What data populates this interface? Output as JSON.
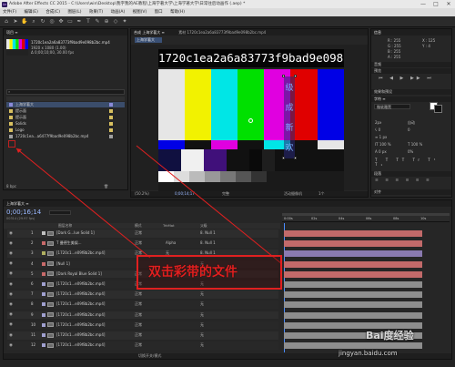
{
  "window": {
    "title": "Adobe After Effects CC 2015 - C:\\Users\\win\\Desktop\\我字我的AE教程\\上海学著大学\\上海学著大学\\日常往后动画作 (.aep) *",
    "icon_label": "Ae",
    "min": "—",
    "max": "□",
    "close": "✕"
  },
  "menu": [
    "文件(F)",
    "编辑(E)",
    "合成(C)",
    "图层(L)",
    "效果(T)",
    "动画(A)",
    "视图(V)",
    "窗口",
    "帮助(H)"
  ],
  "project_panel": {
    "tab": "项目 ≡",
    "preview_name": "1720c1ea2a6a83773f9bad9e098b2bc.mp4",
    "preview_meta_1": "1920 x 1080 (1.00)",
    "preview_meta_2": "Δ 0;00;10;00, 30.00 fps",
    "search_placeholder": "",
    "items": [
      {
        "label": "上海学著大",
        "color": "#8a8ad8"
      },
      {
        "label": "提示面",
        "color": "#d8c060"
      },
      {
        "label": "提示面",
        "color": "#d8c060"
      },
      {
        "label": "Solids",
        "color": "#d8c060"
      },
      {
        "label": "Logo",
        "color": "#d8c060"
      },
      {
        "label": "1720c1ea...a6477f9bad9e098b2bc.mp4",
        "color": "#a0a0a0"
      }
    ],
    "bit_depth": "8 bpc"
  },
  "composition": {
    "tab": "合成 上海学著大 ≡",
    "tab2": "素材 1720c1ea2a6a83773f9bad9e098b2bc.mp4",
    "subtab": "上海学著大",
    "overlay_text": "1720c1ea2a6a83773f9bad9e098",
    "vertical_text": [
      "级",
      "成",
      "新",
      "欢"
    ],
    "zoom": "(50.2%)",
    "timecode": "0;00;14;17",
    "quality": "完整",
    "camera": "活动摄像机",
    "view": "1个"
  },
  "right_panel": {
    "info_tab": "信息",
    "info_values": [
      "R : 255",
      "G : 255",
      "B : 255",
      "A : 255"
    ],
    "info_xy": [
      "X : 125",
      "Y : 4"
    ],
    "audio_tab": "音频",
    "preview_tab": "预览",
    "effects_tab": "效果和预设",
    "character_tab": "字符 ≡",
    "font": "微软雅黑",
    "font_size": "2px",
    "leading": "自动",
    "tracking": "0",
    "tsume": "0%",
    "paragraph_tab": "段落",
    "align_tab": "对齐"
  },
  "timeline": {
    "tab": "上海学著大 ≡",
    "timecode": "0;00;16;14",
    "timecode_sub": "00314 (29.97 fps)",
    "col_name": "图层名称",
    "col_mode": "模式",
    "col_trkmat": "TrkMat",
    "col_parent": "父级",
    "ruler": [
      "0:00s",
      "02s",
      "04s",
      "06s",
      "08s",
      "10s"
    ],
    "footer_label": "切换开关/模式",
    "layers": [
      {
        "num": "1",
        "name": "[Dark G...lue Solid 1]",
        "mode": "正常",
        "trk": "",
        "parent": "8. Null 1",
        "color": "#c0c0c0",
        "bar": "#c26a6a"
      },
      {
        "num": "2",
        "name": "T 曼德生美娱...",
        "mode": "正常",
        "trk": "Alpha",
        "parent": "8. Null 1",
        "color": "#c86a6a",
        "bar": "#c26a6a"
      },
      {
        "num": "3",
        "name": "[1720c1...e09f8b2bc.mp4]",
        "mode": "正常",
        "trk": "无",
        "parent": "8. Null 1",
        "color": "#b0b060",
        "bar": "#8a7ab0"
      },
      {
        "num": "4",
        "name": "[Null 1]",
        "mode": "",
        "trk": "",
        "parent": "无",
        "color": "#c86a6a",
        "bar": "#c26a6a"
      },
      {
        "num": "5",
        "name": "[Dark Royal Blue Solid 1]",
        "mode": "正常",
        "trk": "",
        "parent": "无",
        "color": "#c86a6a",
        "bar": "#c26a6a"
      },
      {
        "num": "6",
        "name": "[1720c1...e09f8b2bc.mp4]",
        "mode": "正常",
        "trk": "",
        "parent": "无",
        "color": "#a0a0d0",
        "bar": "#8e8e8e"
      },
      {
        "num": "7",
        "name": "[1720c1...e09f8b2bc.mp4]",
        "mode": "正常",
        "trk": "",
        "parent": "无",
        "color": "#a0a0d0",
        "bar": "#8e8e8e"
      },
      {
        "num": "8",
        "name": "[1720c1...e09f8b2bc.mp4]",
        "mode": "正常",
        "trk": "",
        "parent": "无",
        "color": "#a0a0d0",
        "bar": "#8e8e8e"
      },
      {
        "num": "9",
        "name": "[1720c1...e09f8b2bc.mp4]",
        "mode": "正常",
        "trk": "",
        "parent": "无",
        "color": "#a0a0d0",
        "bar": "#8e8e8e"
      },
      {
        "num": "10",
        "name": "[1720c1...e09f8b2bc.mp4]",
        "mode": "正常",
        "trk": "",
        "parent": "无",
        "color": "#a0a0d0",
        "bar": "#8e8e8e"
      },
      {
        "num": "11",
        "name": "[1720c1...e09f8b2bc.mp4]",
        "mode": "正常",
        "trk": "",
        "parent": "无",
        "color": "#a0a0d0",
        "bar": "#8e8e8e"
      },
      {
        "num": "12",
        "name": "[1720c1...e09f8b2bc.mp4]",
        "mode": "正常",
        "trk": "",
        "parent": "无",
        "color": "#a0a0d0",
        "bar": "#8e8e8e"
      }
    ]
  },
  "annotation": {
    "callout_text": "双击彩带的文件",
    "box_color": "#e02020",
    "text_color": "#e02020"
  },
  "watermark": {
    "site": "jingyan.baidu.com",
    "brand": "Bai度经验"
  },
  "colors": {
    "bars_top": [
      "#e6e6e6",
      "#f2f200",
      "#00e6e6",
      "#00e000",
      "#e000e0",
      "#e00000",
      "#0000e6"
    ],
    "bars_mid": [
      "#0000e6",
      "#101010",
      "#e000e0",
      "#101010",
      "#00e6e6",
      "#101010",
      "#e6e6e6"
    ]
  }
}
